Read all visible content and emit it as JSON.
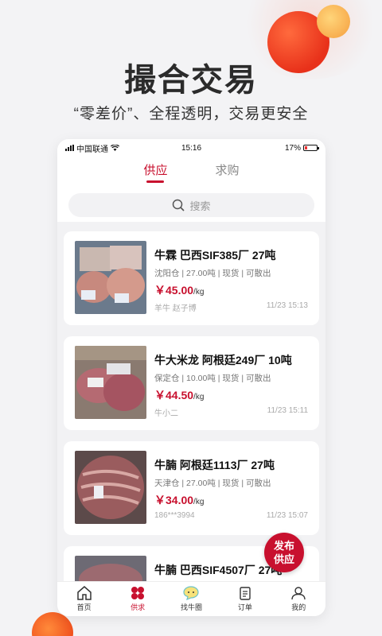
{
  "promo": {
    "headline": "撮合交易",
    "subline": "“零差价”、全程透明，交易更安全"
  },
  "status_bar": {
    "carrier": "中国联通",
    "time": "15:16",
    "battery": "17%"
  },
  "tabs": [
    {
      "label": "供应",
      "active": true
    },
    {
      "label": "求购",
      "active": false
    }
  ],
  "search": {
    "placeholder": "搜索"
  },
  "listings": [
    {
      "title": "牛霖 巴西SIF385厂 27吨",
      "meta": "沈阳仓 | 27.00吨 | 现货 | 可散出",
      "price": "￥45.00",
      "unit": "/kg",
      "seller": "羊牛 赵子博",
      "time": "11/23 15:13"
    },
    {
      "title": "牛大米龙 阿根廷249厂 10吨",
      "meta": "保定仓 | 10.00吨 | 现货 | 可散出",
      "price": "￥44.50",
      "unit": "/kg",
      "seller": "牛小二",
      "time": "11/23 15:11"
    },
    {
      "title": "牛腩 阿根廷1113厂 27吨",
      "meta": "天津仓 | 27.00吨 | 现货 | 可散出",
      "price": "￥34.00",
      "unit": "/kg",
      "seller": "186***3994",
      "time": "11/23 15:07"
    },
    {
      "title": "牛腩 巴西SIF4507厂 27吨",
      "meta": "",
      "price": "",
      "unit": "",
      "seller": "",
      "time": ""
    }
  ],
  "publish_button": {
    "line1": "发布",
    "line2": "供应"
  },
  "bottom_nav": [
    {
      "label": "首页",
      "icon": "home-icon",
      "active": false
    },
    {
      "label": "供求",
      "icon": "supply-demand-icon",
      "active": true
    },
    {
      "label": "找牛圈",
      "icon": "chat-bubble-icon",
      "active": false
    },
    {
      "label": "订单",
      "icon": "order-clipboard-icon",
      "active": false
    },
    {
      "label": "我的",
      "icon": "user-icon",
      "active": false
    }
  ],
  "colors": {
    "accent": "#c8102e",
    "background": "#f3f3f5"
  }
}
